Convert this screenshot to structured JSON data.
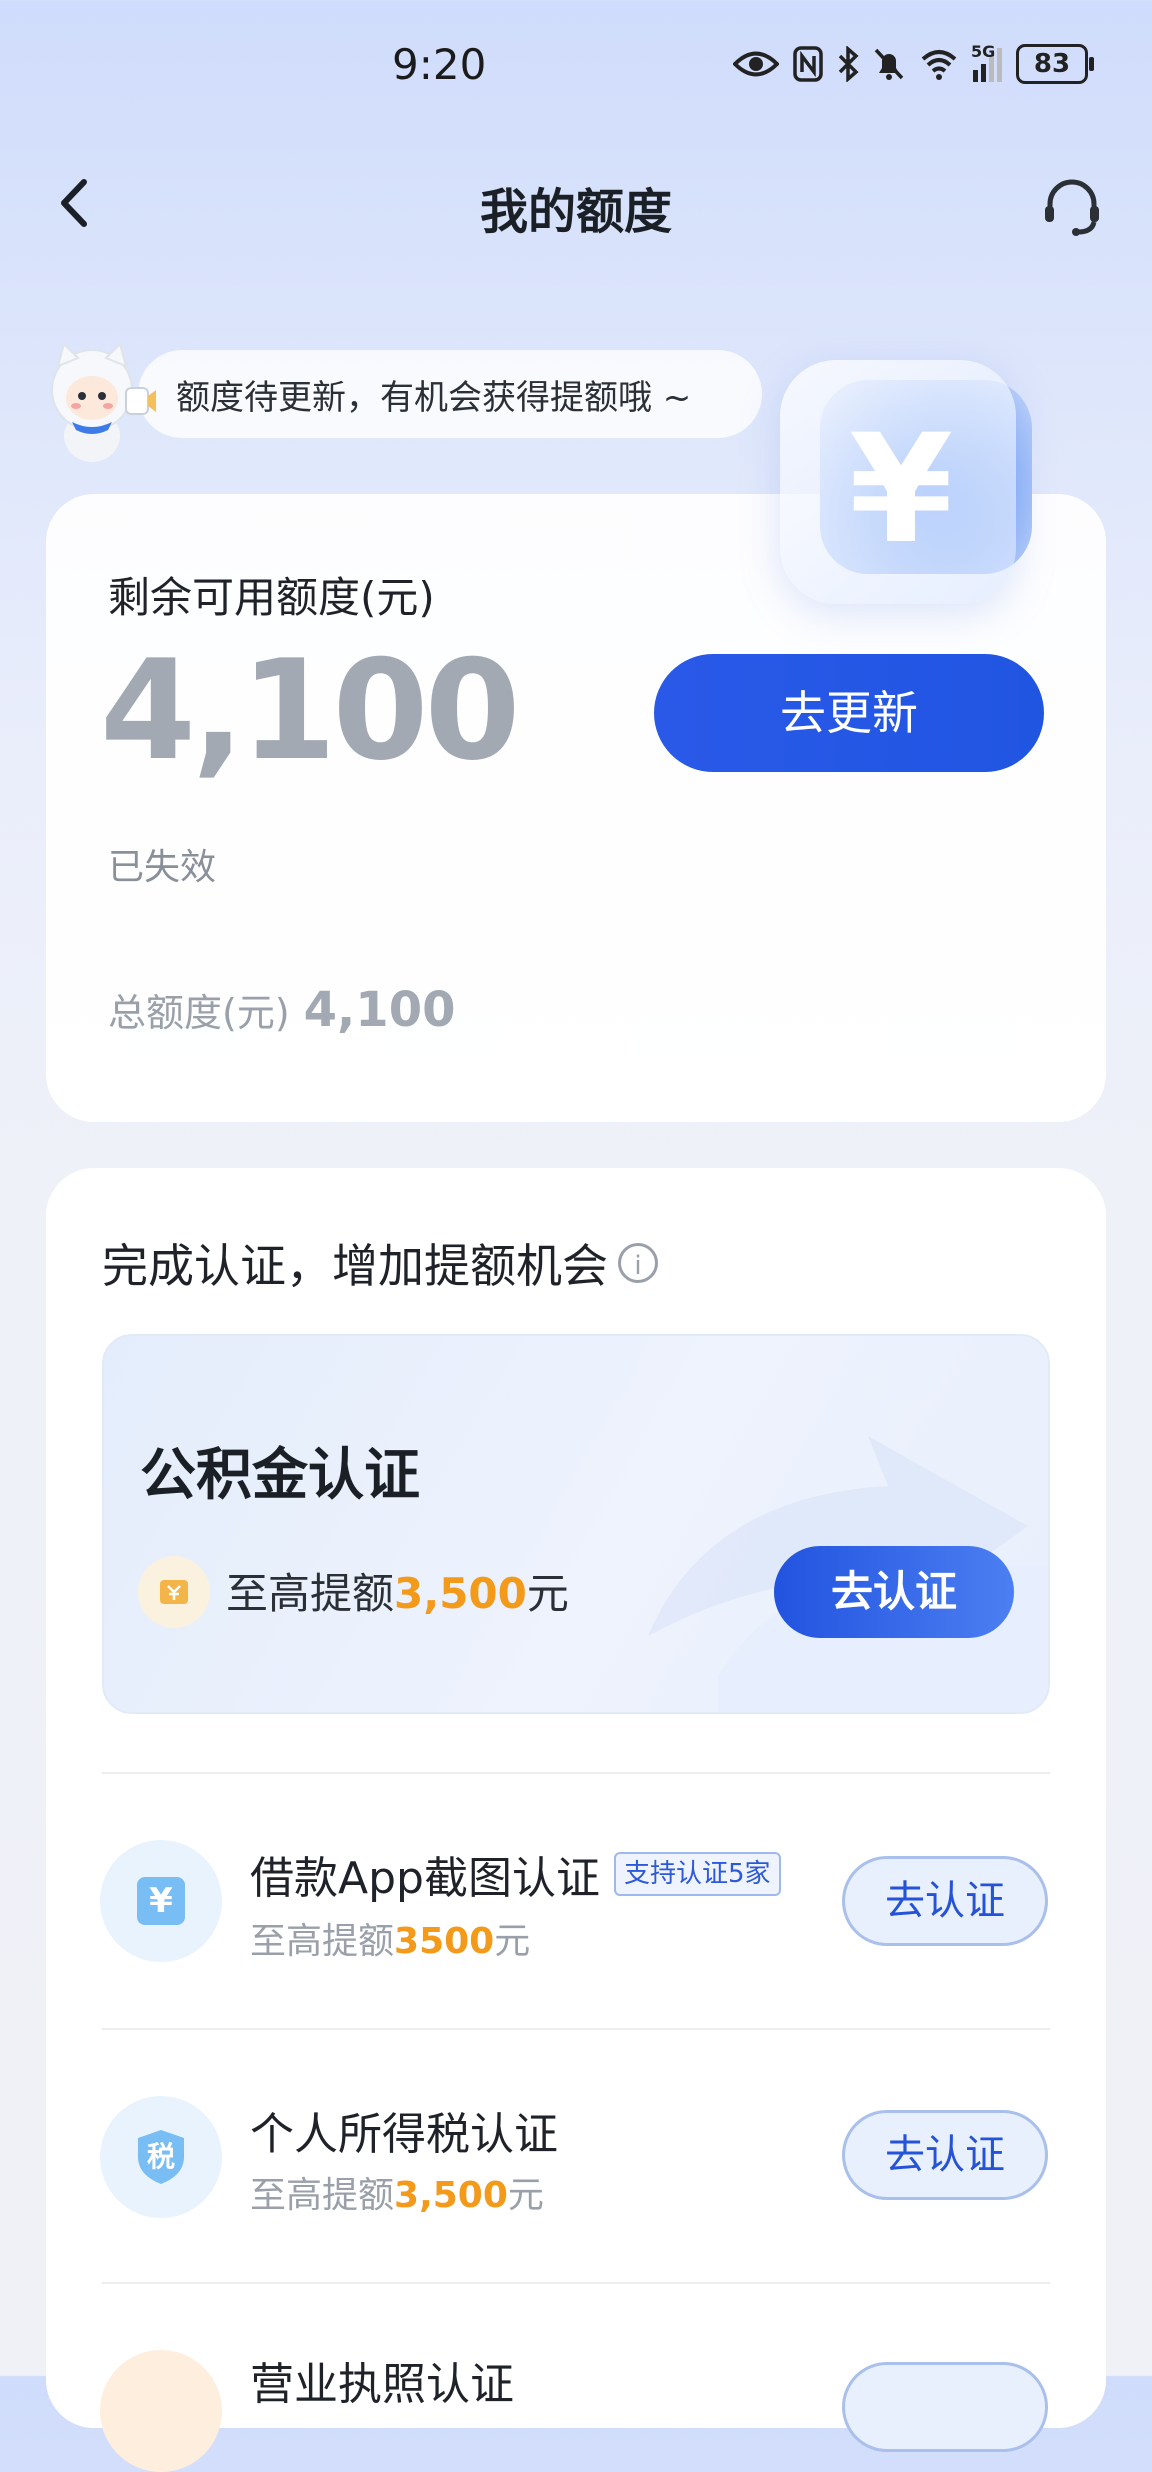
{
  "status_bar": {
    "time": "9:20",
    "battery": "83",
    "network": "5G"
  },
  "header": {
    "title": "我的额度"
  },
  "banner": {
    "tip": "额度待更新，有机会获得提额哦 ~"
  },
  "quota_card": {
    "available_label": "剩余可用额度(元)",
    "available_amount": "4,100",
    "update_button": "去更新",
    "status": "已失效",
    "total_label": "总额度(元)",
    "total_amount": "4,100",
    "yuan_symbol": "¥"
  },
  "cert_section": {
    "title": "完成认证，增加提额机会",
    "featured": {
      "title": "公积金认证",
      "limit_prefix": "至高提额",
      "limit_amount": "3,500",
      "limit_suffix": "元",
      "button": "去认证"
    },
    "items": [
      {
        "title": "借款App截图认证",
        "tag": "支持认证5家",
        "limit_prefix": "至高提额",
        "limit_amount": "3500",
        "limit_suffix": "元",
        "button": "去认证",
        "icon": "yuan-icon",
        "icon_glyph": "¥"
      },
      {
        "title": "个人所得税认证",
        "limit_prefix": "至高提额",
        "limit_amount": "3,500",
        "limit_suffix": "元",
        "button": "去认证",
        "icon": "tax-shield-icon",
        "icon_glyph": "税"
      },
      {
        "title": "营业执照认证",
        "icon": "license-icon"
      }
    ]
  },
  "colors": {
    "primary": "#2458e4",
    "accent_orange": "#f39a1a",
    "muted_amount": "#a3a9b3"
  }
}
